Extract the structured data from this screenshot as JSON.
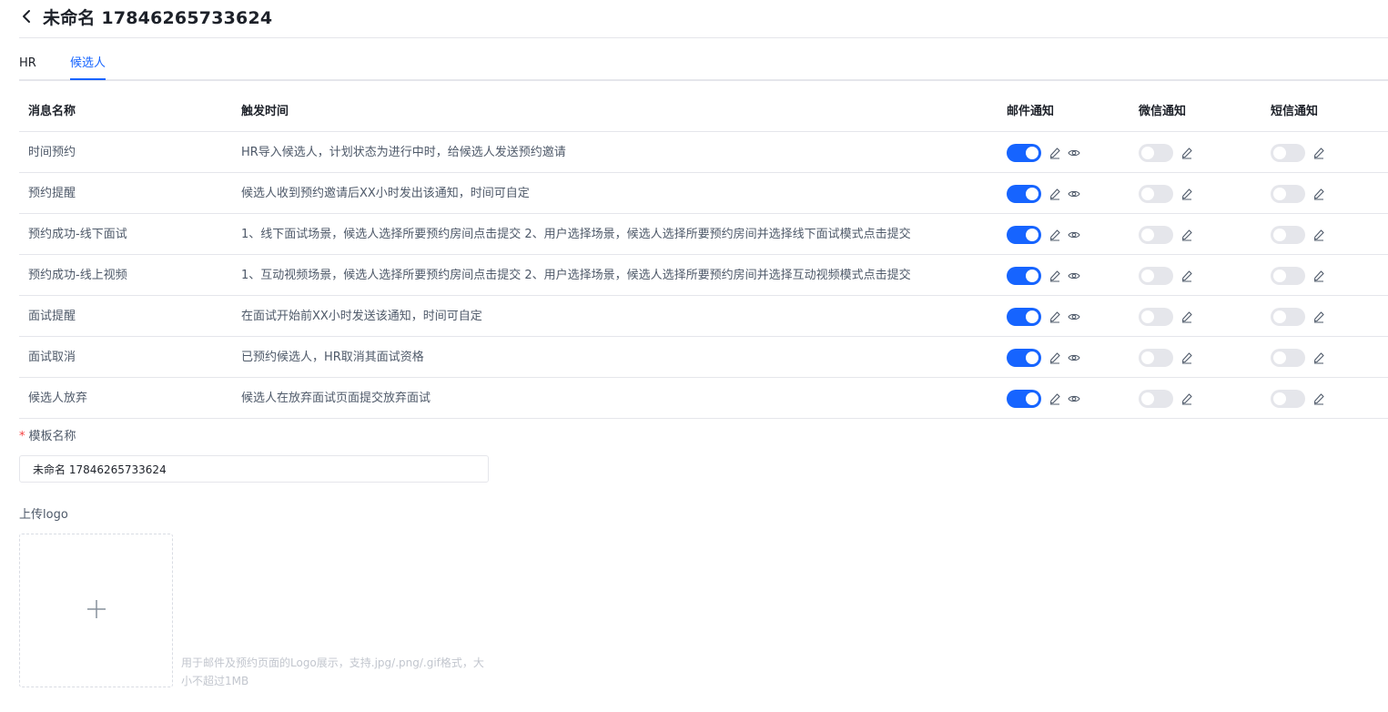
{
  "header": {
    "title": "未命名 17846265733624"
  },
  "tabs": [
    {
      "label": "HR",
      "active": false
    },
    {
      "label": "候选人",
      "active": true
    }
  ],
  "table": {
    "columns": {
      "name": "消息名称",
      "trigger": "触发时间",
      "email": "邮件通知",
      "wechat": "微信通知",
      "sms": "短信通知"
    },
    "rows": [
      {
        "name": "时间预约",
        "trigger": "HR导入候选人，计划状态为进行中时，给候选人发送预约邀请",
        "email": true,
        "wechat": false,
        "sms": false
      },
      {
        "name": "预约提醒",
        "trigger": "候选人收到预约邀请后XX小时发出该通知，时间可自定",
        "email": true,
        "wechat": false,
        "sms": false
      },
      {
        "name": "预约成功-线下面试",
        "trigger": "1、线下面试场景，候选人选择所要预约房间点击提交 2、用户选择场景，候选人选择所要预约房间并选择线下面试模式点击提交",
        "email": true,
        "wechat": false,
        "sms": false
      },
      {
        "name": "预约成功-线上视频",
        "trigger": "1、互动视频场景，候选人选择所要预约房间点击提交 2、用户选择场景，候选人选择所要预约房间并选择互动视频模式点击提交",
        "email": true,
        "wechat": false,
        "sms": false
      },
      {
        "name": "面试提醒",
        "trigger": "在面试开始前XX小时发送该通知，时间可自定",
        "email": true,
        "wechat": false,
        "sms": false
      },
      {
        "name": "面试取消",
        "trigger": "已预约候选人，HR取消其面试资格",
        "email": true,
        "wechat": false,
        "sms": false
      },
      {
        "name": "候选人放弃",
        "trigger": "候选人在放弃面试页面提交放弃面试",
        "email": true,
        "wechat": false,
        "sms": false
      }
    ]
  },
  "form": {
    "required_mark": "*",
    "template_name_label": "模板名称",
    "template_name_value": "未命名 17846265733624",
    "upload_label": "上传logo",
    "upload_hint": "用于邮件及预约页面的Logo展示，支持.jpg/.png/.gif格式，大小不超过1MB"
  },
  "colors": {
    "primary": "#1664ff",
    "switch_off": "#e5e6eb",
    "required": "#f53f3f"
  },
  "icons": {
    "back": "chevron-left-icon",
    "edit": "pen-icon",
    "preview": "eye-icon",
    "upload": "plus-icon"
  }
}
